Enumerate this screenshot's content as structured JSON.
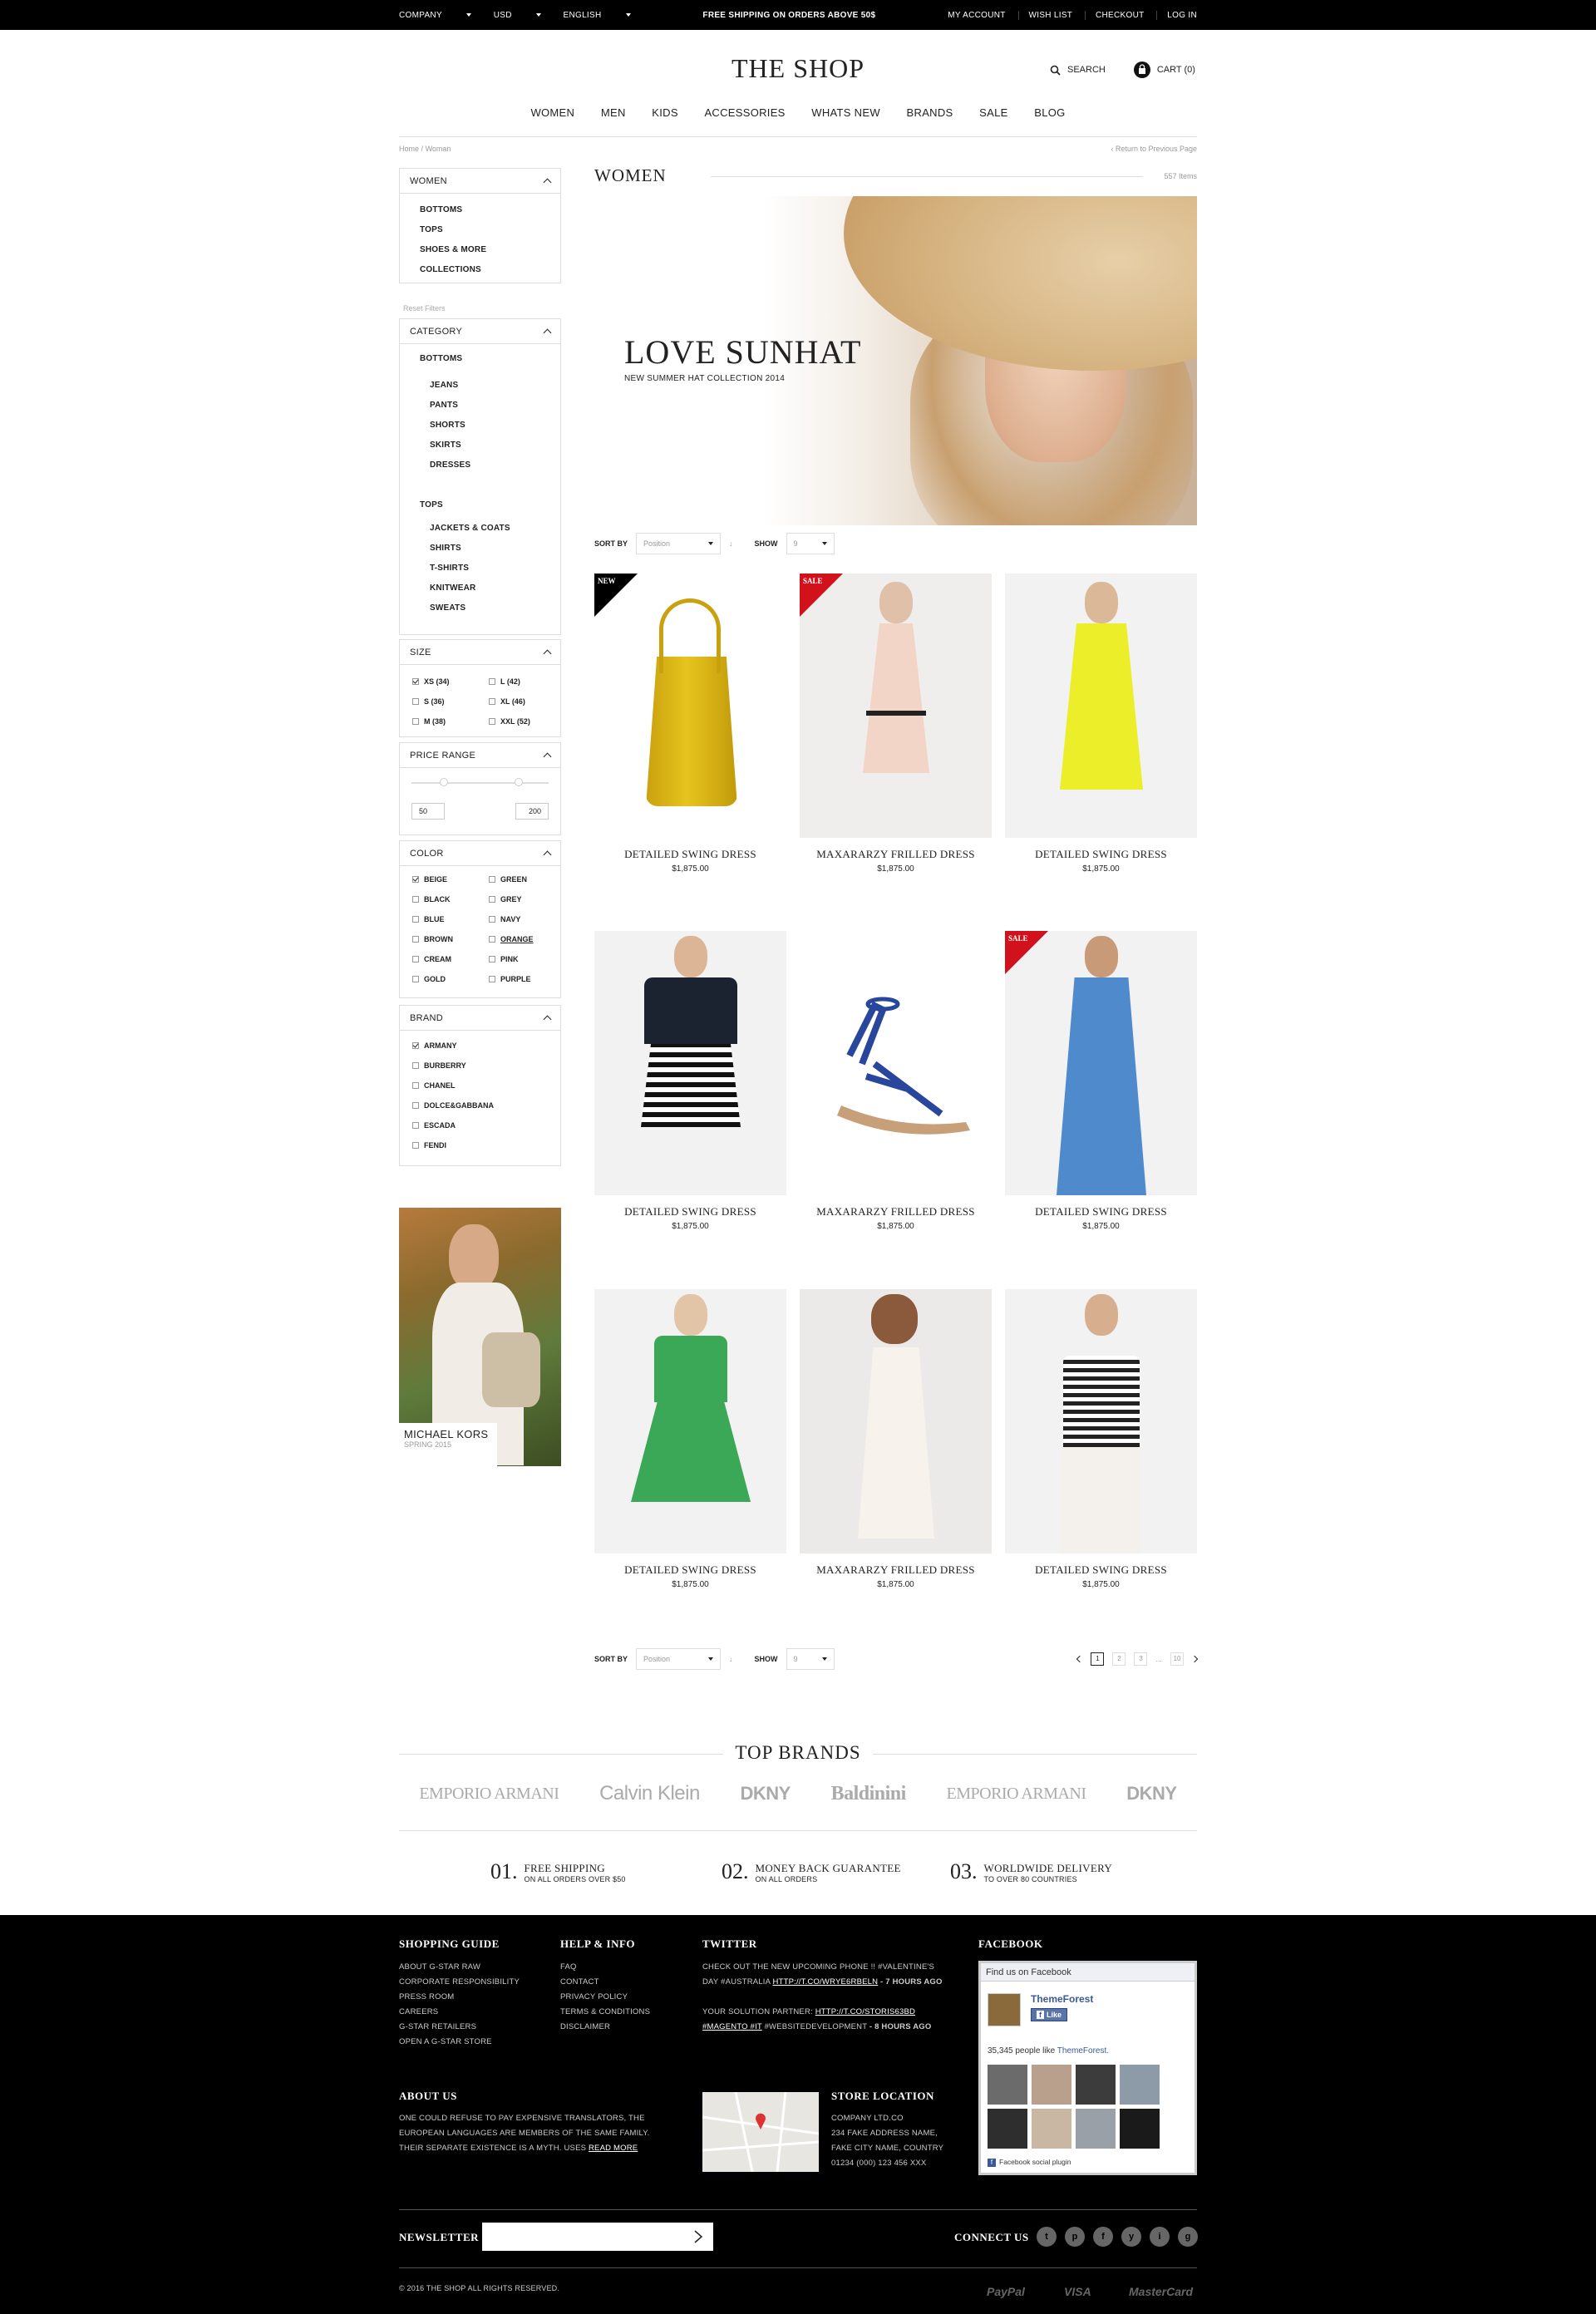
{
  "topbar": {
    "company": "COMPANY",
    "currency": "USD",
    "language": "ENGLISH",
    "promo": "FREE SHIPPING ON ORDERS ABOVE 50$",
    "my_account": "MY ACCOUNT",
    "wish_list": "WISH LIST",
    "checkout": "CHECKOUT",
    "login": "LOG IN"
  },
  "header": {
    "logo": "THE SHOP",
    "search": "SEARCH",
    "cart": "CART (0)"
  },
  "nav": [
    "WOMEN",
    "MEN",
    "KIDS",
    "ACCESSORIES",
    "WHATS NEW",
    "BRANDS",
    "SALE",
    "BLOG"
  ],
  "breadcrumb": {
    "home": "Home",
    "sep": "/",
    "current": "Woman",
    "back": "‹ Return to Previous Page"
  },
  "sidebar": {
    "women": {
      "title": "WOMEN",
      "items": [
        "BOTTOMS",
        "TOPS",
        "SHOES & MORE",
        "COLLECTIONS"
      ]
    },
    "reset": "Reset Filters",
    "category": {
      "title": "CATEGORY",
      "bottoms": "BOTTOMS",
      "bottoms_items": [
        "JEANS",
        "PANTS",
        "SHORTS",
        "SKIRTS",
        "DRESSES"
      ],
      "tops": "TOPS",
      "tops_items": [
        "JACKETS & COATS",
        "SHIRTS",
        "T-SHIRTS",
        "KNITWEAR",
        "SWEATS"
      ]
    },
    "size": {
      "title": "SIZE",
      "items": [
        "XS (34)",
        "L (42)",
        "S (36)",
        "XL (46)",
        "M (38)",
        "XXL (52)"
      ]
    },
    "price": {
      "title": "PRICE RANGE",
      "min": "50",
      "max": "200"
    },
    "color": {
      "title": "COLOR",
      "items": [
        "BEIGE",
        "GREEN",
        "BLACK",
        "GREY",
        "BLUE",
        "NAVY",
        "BROWN",
        "ORANGE",
        "CREAM",
        "PINK",
        "GOLD",
        "PURPLE"
      ]
    },
    "brand": {
      "title": "BRAND",
      "items": [
        "ARMANY",
        "BURBERRY",
        "CHANEL",
        "DOLCE&GABBANA",
        "ESCADA",
        "FENDI"
      ]
    },
    "promo": {
      "title": "MICHAEL KORS",
      "subtitle": "SPRING 2015"
    }
  },
  "main": {
    "title": "WOMEN",
    "count": "557 Items",
    "banner": {
      "title": "LOVE SUNHAT",
      "subtitle": "NEW SUMMER HAT COLLECTION 2014"
    },
    "sort": {
      "label": "SORT BY",
      "value": "Position",
      "show_label": "SHOW",
      "show_value": "9"
    },
    "pagination": [
      "1",
      "2",
      "3",
      "...",
      "10"
    ],
    "products": [
      {
        "name": "DETAILED SWING DRESS",
        "price": "$1,875.00",
        "tag": "NEW"
      },
      {
        "name": "MAXARARZY FRILLED DRESS",
        "price": "$1,875.00",
        "tag": "SALE"
      },
      {
        "name": "DETAILED SWING DRESS",
        "price": "$1,875.00",
        "tag": ""
      },
      {
        "name": "DETAILED SWING DRESS",
        "price": "$1,875.00",
        "tag": ""
      },
      {
        "name": "MAXARARZY FRILLED DRESS",
        "price": "$1,875.00",
        "tag": ""
      },
      {
        "name": "DETAILED SWING DRESS",
        "price": "$1,875.00",
        "tag": "SALE"
      },
      {
        "name": "DETAILED SWING DRESS",
        "price": "$1,875.00",
        "tag": ""
      },
      {
        "name": "MAXARARZY FRILLED DRESS",
        "price": "$1,875.00",
        "tag": ""
      },
      {
        "name": "DETAILED SWING DRESS",
        "price": "$1,875.00",
        "tag": ""
      }
    ]
  },
  "brands": {
    "title": "TOP BRANDS",
    "items": [
      "EMPORIO ARMANI",
      "Calvin Klein",
      "DKNY",
      "Baldinini",
      "EMPORIO ARMANI",
      "DKNY"
    ]
  },
  "features": [
    {
      "num": "01.",
      "title": "FREE SHIPPING",
      "sub": "ON ALL ORDERS OVER $50"
    },
    {
      "num": "02.",
      "title": "MONEY BACK GUARANTEE",
      "sub": "ON ALL ORDERS"
    },
    {
      "num": "03.",
      "title": "WORLDWIDE DELIVERY",
      "sub": "TO OVER 80 COUNTRIES"
    }
  ],
  "footer": {
    "shopping": {
      "title": "SHOPPING GUIDE",
      "items": [
        "ABOUT G-STAR RAW",
        "CORPORATE RESPONSIBILITY",
        "PRESS ROOM",
        "CAREERS",
        "G-STAR RETAILERS",
        "OPEN A G-STAR STORE"
      ]
    },
    "help": {
      "title": "HELP & INFO",
      "items": [
        "FAQ",
        "CONTACT",
        "PRIVACY POLICY",
        "TERMS & CONDITIONS",
        "DISCLAIMER"
      ]
    },
    "twitter": {
      "title": "TWITTER",
      "t1": "CHECK OUT THE NEW UPCOMING PHONE !! #VALENTINE'S DAY #AUSTRALIA",
      "t1_link": "HTTP://T.CO/WRYE6RBELN",
      "t1_time": "- 7 HOURS AGO",
      "t2": "YOUR SOLUTION PARTNER:",
      "t2_link": "HTTP://T.CO/STORIS63BD #MAGENTO #IT",
      "t2_rest": "#WEBSITEDEVELOPMENT",
      "t2_time": "- 8 HOURS AGO"
    },
    "facebook": {
      "title": "FACEBOOK",
      "box_title": "Find us on Facebook",
      "page": "ThemeForest",
      "like": "Like",
      "likes": "35,345 people like",
      "likes_page": "ThemeForest.",
      "plugin": "Facebook social plugin"
    },
    "about": {
      "title": "ABOUT US",
      "text": "ONE COULD REFUSE TO PAY EXPENSIVE TRANSLATORS, THE EUROPEAN LANGUAGES ARE MEMBERS OF THE SAME FAMILY. THEIR SEPARATE EXISTENCE IS A MYTH. USES",
      "link": "READ MORE"
    },
    "store": {
      "title": "STORE LOCATION",
      "lines": [
        "COMPANY LTD.CO",
        "234 FAKE ADDRESS NAME,",
        "FAKE CITY NAME, COUNTRY",
        "01234 (000) 123 456 XXX"
      ]
    },
    "newsletter": "NEWSLETTER",
    "connect": "CONNECT US",
    "social": [
      "t",
      "p",
      "f",
      "y",
      "i",
      "g"
    ],
    "copyright": "© 2016 THE SHOP ALL RIGHTS RESERVED.",
    "payments": [
      "PayPal",
      "VISA",
      "MasterCard"
    ]
  }
}
